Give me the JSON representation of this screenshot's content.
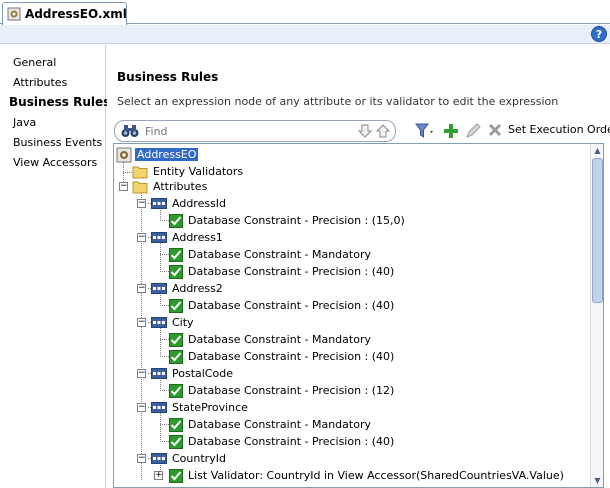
{
  "tab": {
    "label": "AddressEO.xml"
  },
  "help": {
    "label": "?"
  },
  "nav": {
    "items": [
      {
        "label": "General",
        "active": false
      },
      {
        "label": "Attributes",
        "active": false
      },
      {
        "label": "Business Rules",
        "active": true
      },
      {
        "label": "Java",
        "active": false
      },
      {
        "label": "Business Events",
        "active": false
      },
      {
        "label": "View Accessors",
        "active": false
      }
    ]
  },
  "main": {
    "title": "Business Rules",
    "description": "Select an expression node of any attribute or its validator to edit the expression"
  },
  "toolbar": {
    "find_placeholder": "Find",
    "set_order_label": "Set Execution Order"
  },
  "tree": {
    "root": "AddressEO",
    "entity_validators": "Entity Validators",
    "attributes": "Attributes",
    "nodes": [
      {
        "name": "AddressId",
        "rules": [
          "Database Constraint - Precision : (15,0)"
        ]
      },
      {
        "name": "Address1",
        "rules": [
          "Database Constraint - Mandatory",
          "Database Constraint - Precision : (40)"
        ]
      },
      {
        "name": "Address2",
        "rules": [
          "Database Constraint - Precision : (40)"
        ]
      },
      {
        "name": "City",
        "rules": [
          "Database Constraint - Mandatory",
          "Database Constraint - Precision : (40)"
        ]
      },
      {
        "name": "PostalCode",
        "rules": [
          "Database Constraint - Precision : (12)"
        ]
      },
      {
        "name": "StateProvince",
        "rules": [
          "Database Constraint - Mandatory",
          "Database Constraint - Precision : (40)"
        ]
      },
      {
        "name": "CountryId",
        "rules": [
          "List Validator: CountryId in View Accessor(SharedCountriesVA.Value)"
        ]
      }
    ]
  },
  "colors": {
    "selection": "#316ac5",
    "check": "#2e9a2e",
    "folder": "#f3d36b"
  }
}
